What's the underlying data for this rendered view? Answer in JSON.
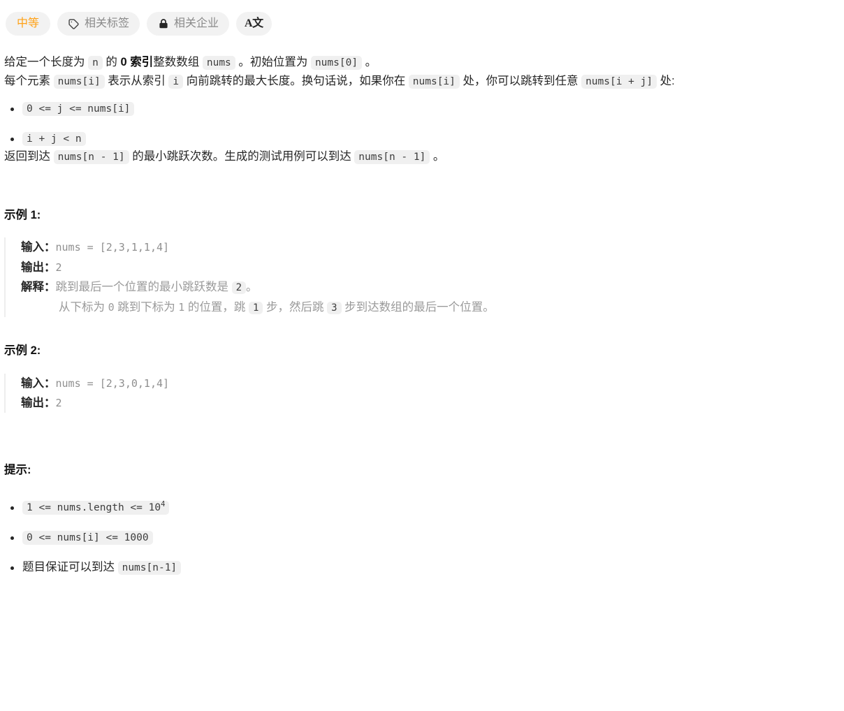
{
  "toolbar": {
    "difficulty": "中等",
    "tags_label": "相关标签",
    "companies_label": "相关企业",
    "translate_label": "A文",
    "tag_icon": "tag-icon",
    "lock_icon": "lock-icon",
    "translate_icon": "translate-icon"
  },
  "description": {
    "p1": {
      "s1": "给定一个长度为 ",
      "c1": "n",
      "s2": " 的 ",
      "b1": "0 索引",
      "s3": "整数数组 ",
      "c2": "nums",
      "s4": " 。初始位置为 ",
      "c3": "nums[0]",
      "s5": " 。"
    },
    "p2": {
      "s1": "每个元素 ",
      "c1": "nums[i]",
      "s2": " 表示从索引 ",
      "c2": "i",
      "s3": " 向前跳转的最大长度。换句话说，如果你在 ",
      "c3": "nums[i]",
      "s4": " 处，你可以跳转到任意 ",
      "c4": "nums[i + j]",
      "s5": " 处:"
    },
    "conditions": [
      "0 <= j <= nums[i]",
      "i + j < n"
    ],
    "p3": {
      "s1": "返回到达 ",
      "c1": "nums[n - 1]",
      "s2": " 的最小跳跃次数。生成的测试用例可以到达 ",
      "c2": "nums[n - 1]",
      "s3": " 。"
    }
  },
  "examples": [
    {
      "heading": "示例 1:",
      "input_label": "输入：",
      "input_value": "nums = [2,3,1,1,4]",
      "output_label": "输出：",
      "output_value": "2",
      "explain_label": "解释：",
      "explain_line1": {
        "s1": "跳到最后一个位置的最小跳跃数是 ",
        "c1": "2",
        "s2": "。"
      },
      "explain_line2": {
        "s1": "从下标为 ",
        "n1": "0",
        "s2": " 跳到下标为 ",
        "n2": "1",
        "s3": " 的位置，跳 ",
        "c1": "1",
        "s4": " 步，然后跳 ",
        "c2": "3",
        "s5": " 步到达数组的最后一个位置。"
      }
    },
    {
      "heading": "示例 2:",
      "input_label": "输入：",
      "input_value": "nums = [2,3,0,1,4]",
      "output_label": "输出：",
      "output_value": "2"
    }
  ],
  "constraints": {
    "heading": "提示:",
    "items": [
      {
        "type": "code",
        "pre": "",
        "code": "1 <= nums.length <= 10",
        "sup": "4"
      },
      {
        "type": "code",
        "pre": "",
        "code": "0 <= nums[i] <= 1000",
        "sup": ""
      },
      {
        "type": "text",
        "pre": "题目保证可以到达 ",
        "code": "nums[n-1]",
        "sup": ""
      }
    ]
  },
  "colors": {
    "difficulty_orange": "#ffa116",
    "pill_bg": "#f2f2f2",
    "code_bg": "#f0f0f0",
    "text": "#262626",
    "muted": "#8a8a8a",
    "example_border": "#ededed"
  }
}
